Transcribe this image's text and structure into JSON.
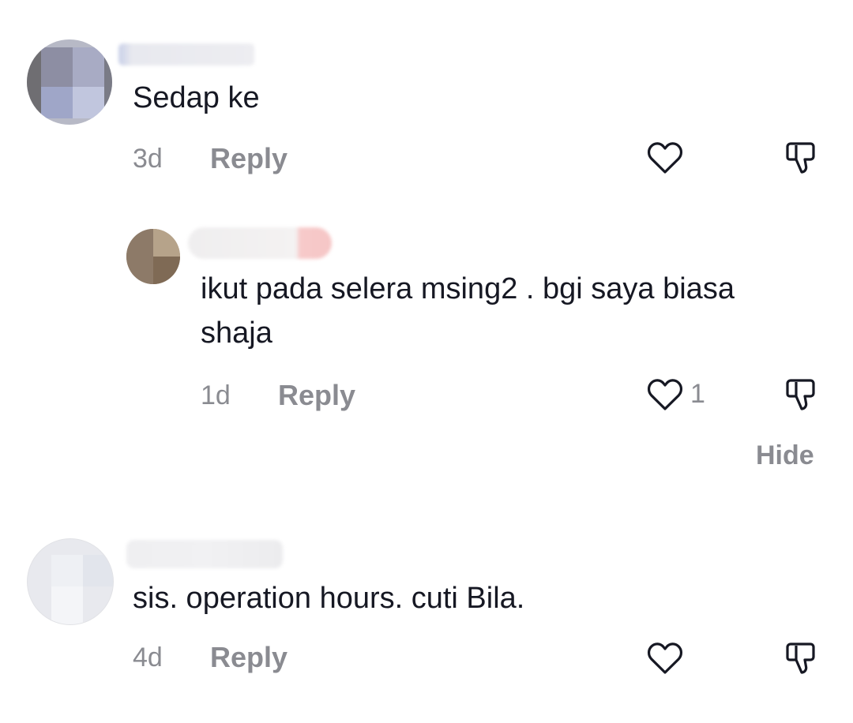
{
  "comments": [
    {
      "text": "Sedap ke",
      "time": "3d",
      "reply_label": "Reply"
    },
    {
      "text": "ikut pada selera msing2 . bgi saya biasa shaja",
      "time": "1d",
      "reply_label": "Reply",
      "like_count": "1",
      "hide_label": "Hide"
    },
    {
      "text": "sis. operation hours. cuti Bila.",
      "time": "4d",
      "reply_label": "Reply"
    }
  ],
  "icons": {
    "like": "heart-outline-icon",
    "dislike": "thumbs-down-outline-icon"
  },
  "colors": {
    "text": "#161823",
    "muted": "#8a8b91",
    "background": "#ffffff"
  }
}
